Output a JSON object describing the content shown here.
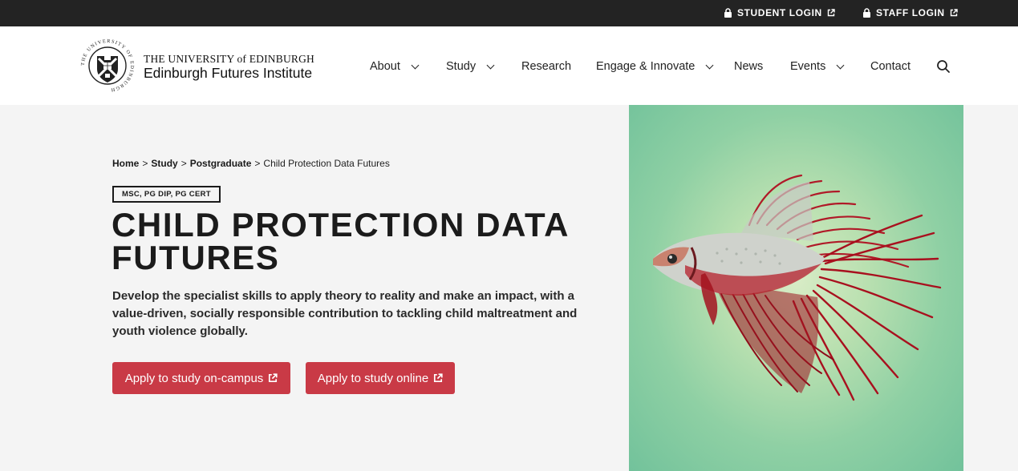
{
  "topbar": {
    "student_login": "STUDENT LOGIN",
    "staff_login": "STAFF LOGIN"
  },
  "brand": {
    "university": "THE UNIVERSITY of EDINBURGH",
    "institute": "Edinburgh Futures Institute",
    "crest_text": "THE UNIVERSITY OF EDINBURGH"
  },
  "nav": {
    "items": [
      {
        "label": "About",
        "has_dropdown": true
      },
      {
        "label": "Study",
        "has_dropdown": true
      },
      {
        "label": "Research",
        "has_dropdown": false
      },
      {
        "label": "Engage & Innovate",
        "has_dropdown": true
      },
      {
        "label": "News",
        "has_dropdown": false
      },
      {
        "label": "Events",
        "has_dropdown": true
      },
      {
        "label": "Contact",
        "has_dropdown": false
      }
    ],
    "search_icon": "search-icon"
  },
  "breadcrumb": {
    "items": [
      "Home",
      "Study",
      "Postgraduate",
      "Child Protection Data Futures"
    ],
    "separator": ">"
  },
  "page": {
    "badge": "MSC, PG DIP, PG CERT",
    "title": "CHILD PROTECTION DATA FUTURES",
    "intro": "Develop the specialist skills to apply theory to reality and make an impact, with a value-driven, socially responsible contribution to tackling child maltreatment and youth violence globally."
  },
  "buttons": {
    "campus": "Apply to study on-campus",
    "online": "Apply to study online"
  },
  "colors": {
    "topbar_bg": "#232323",
    "accent_red": "#c93a46",
    "hero_green": "#72c29b",
    "page_bg": "#f4f4f4"
  },
  "icons": [
    "lock-icon",
    "external-link-icon",
    "chevron-down-icon",
    "search-icon",
    "university-crest-icon"
  ]
}
